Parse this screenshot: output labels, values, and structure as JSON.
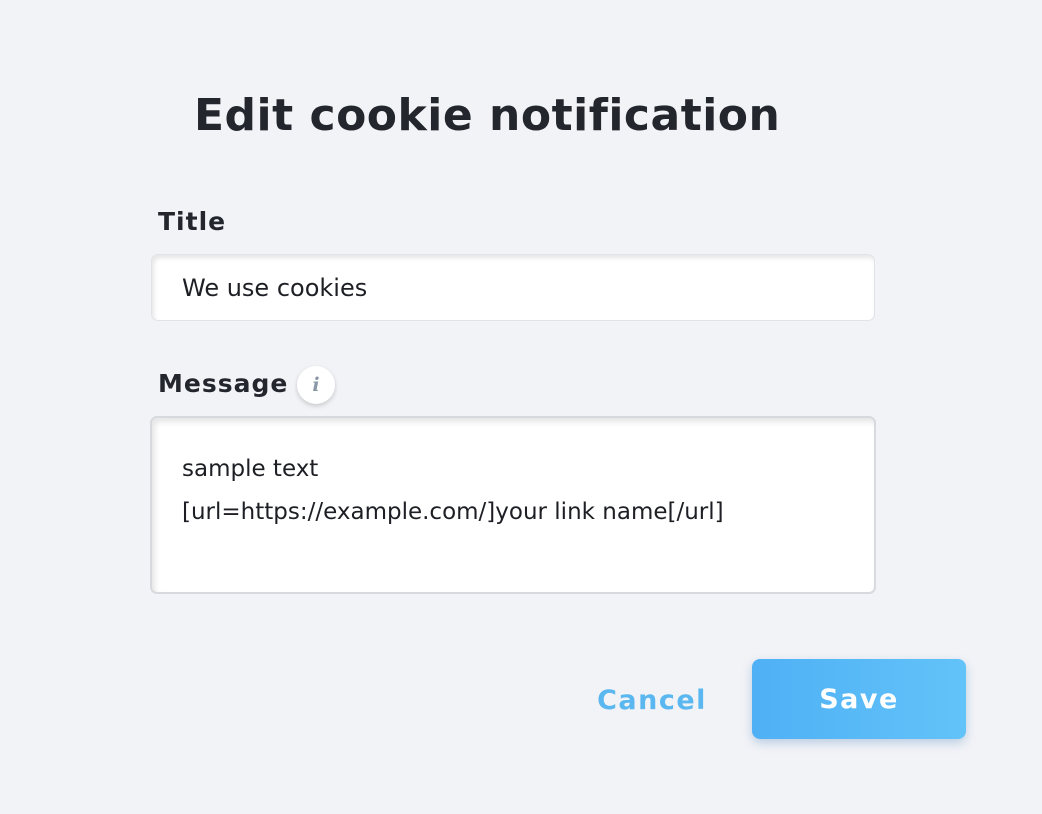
{
  "dialog": {
    "title": "Edit cookie notification"
  },
  "fields": {
    "title": {
      "label": "Title",
      "value": "We use cookies"
    },
    "message": {
      "label": "Message",
      "info_icon": "info-icon",
      "info_glyph": "i",
      "lines": [
        "sample text",
        "[url=https://example.com/]your link name[/url]"
      ]
    }
  },
  "actions": {
    "cancel_label": "Cancel",
    "save_label": "Save"
  },
  "colors": {
    "background": "#f2f3f7",
    "text": "#23262d",
    "accent": "#5ab7ef",
    "save_gradient_start": "#4fb0f5",
    "save_gradient_end": "#62c3f9"
  }
}
